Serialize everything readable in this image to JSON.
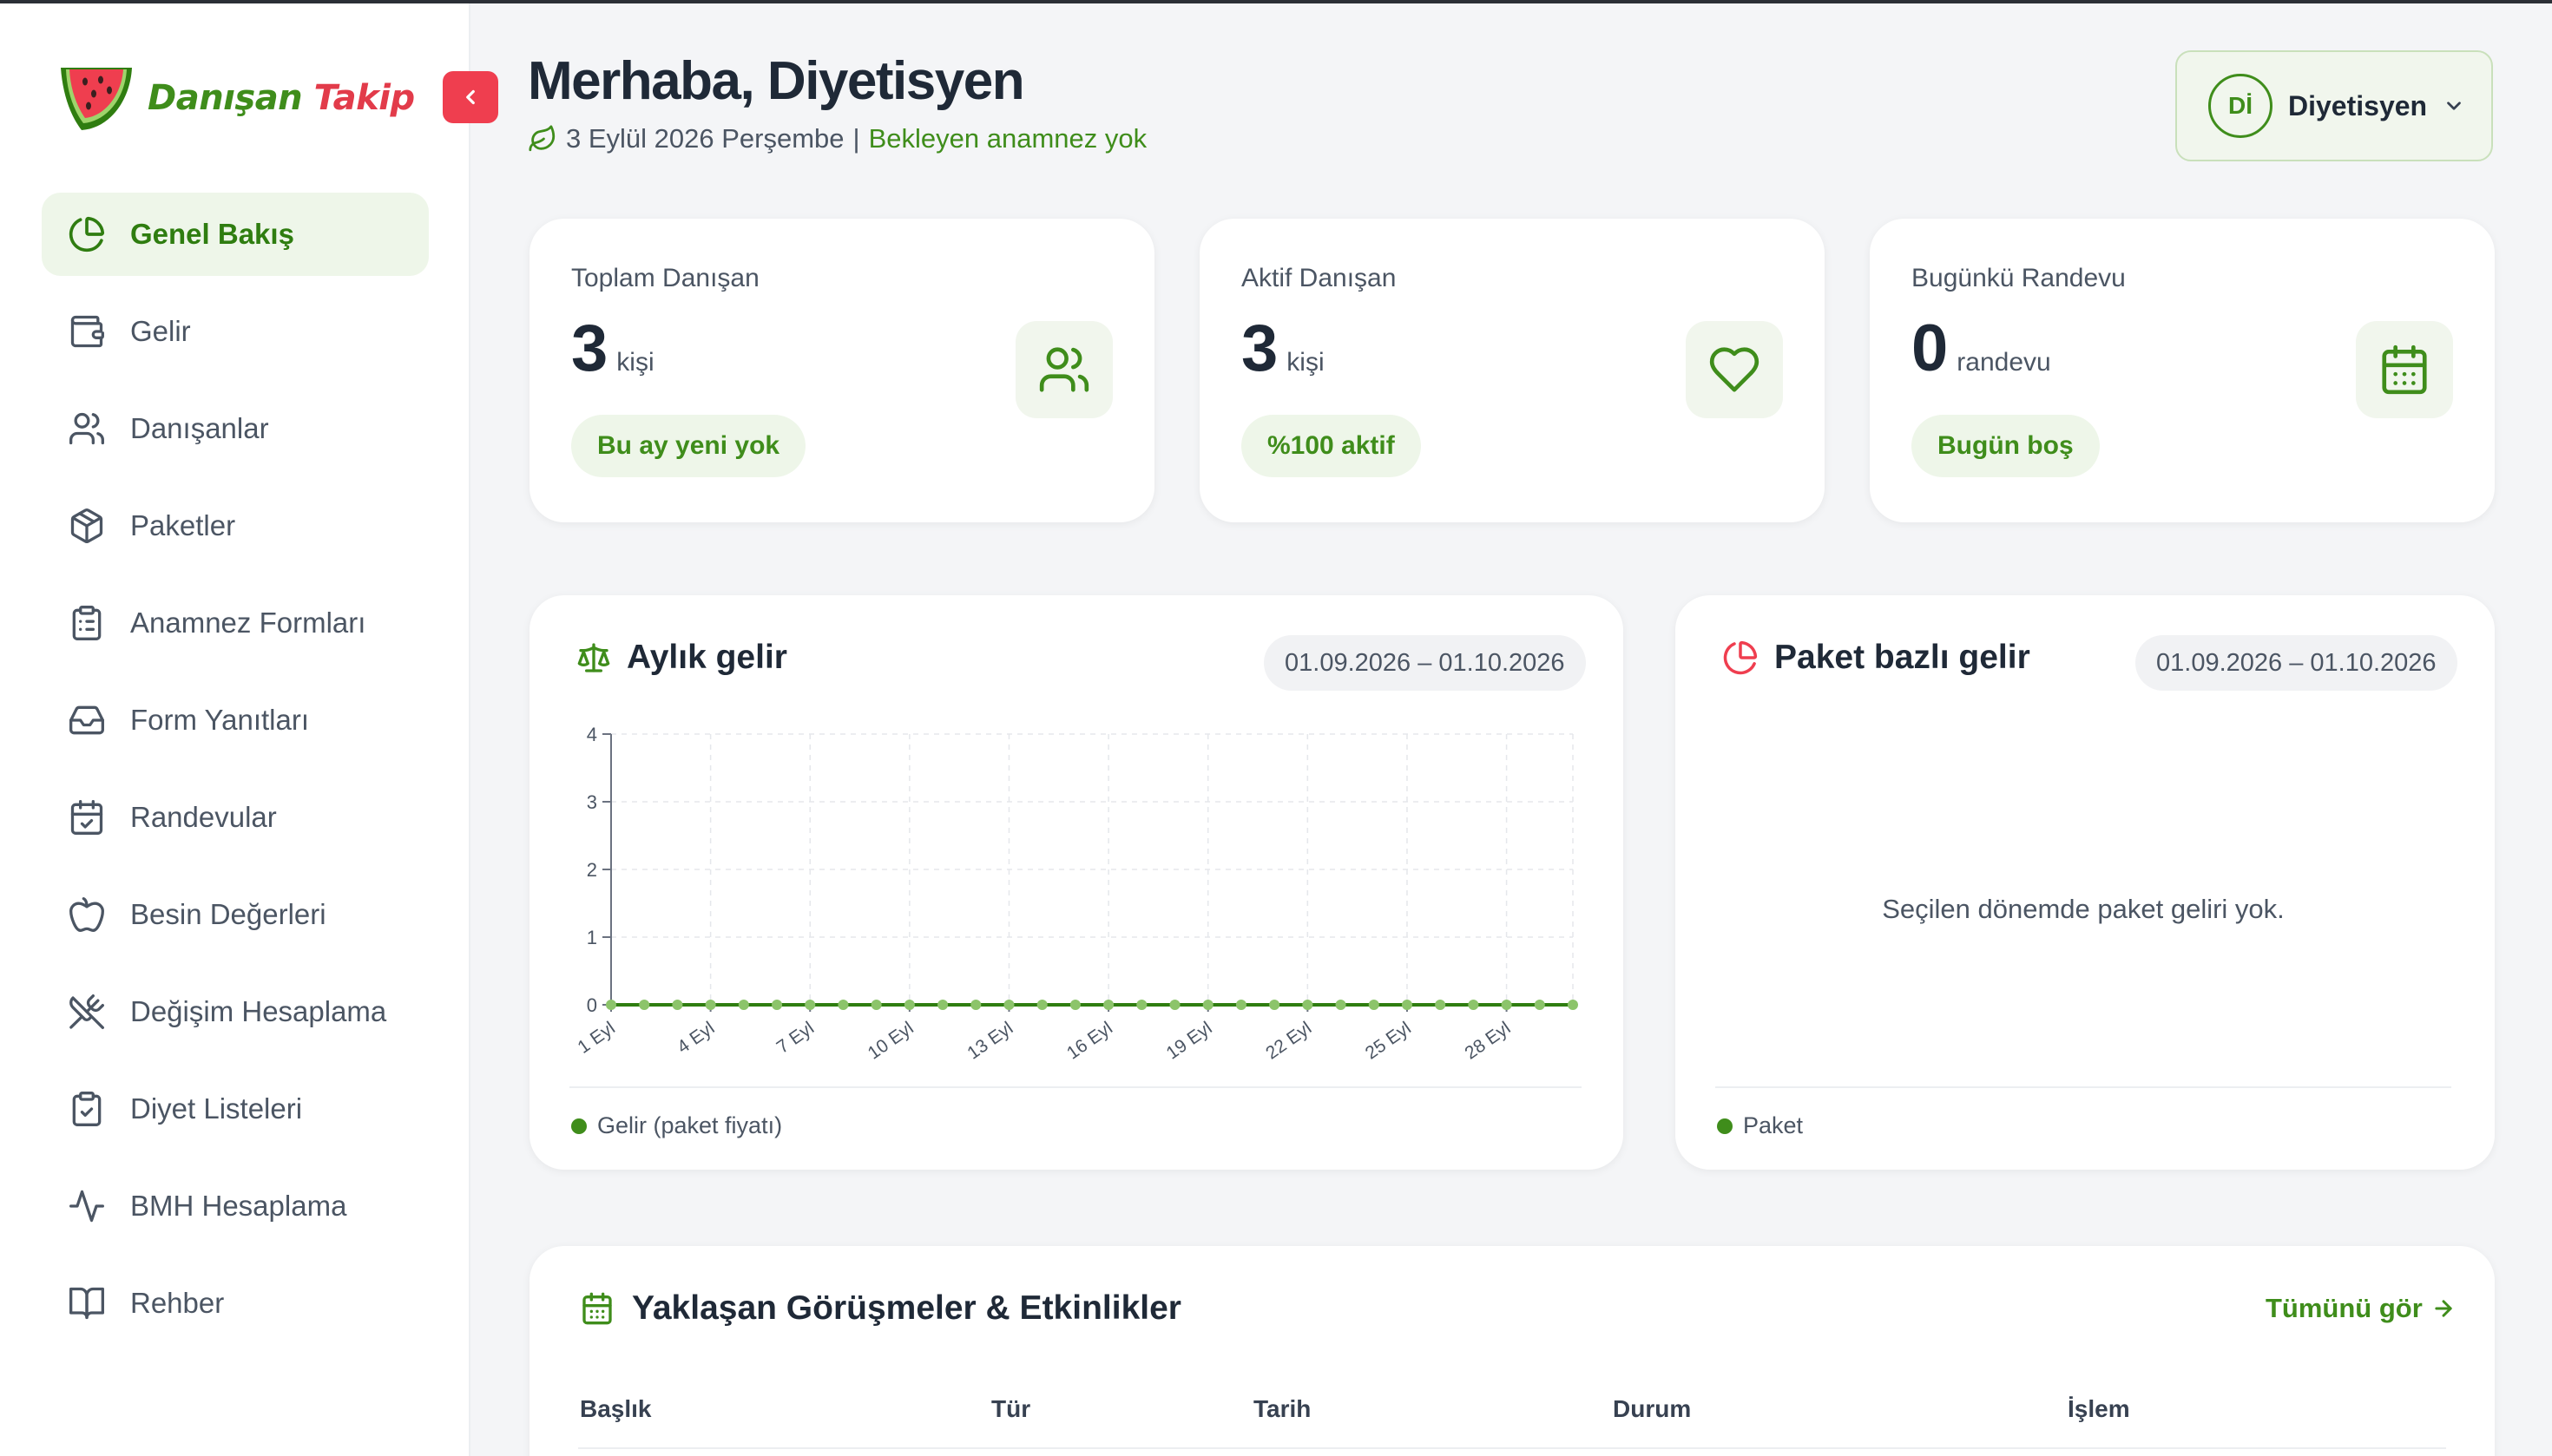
{
  "brand": {
    "name_part1": "Danışan",
    "name_part2": "Takip"
  },
  "nav": {
    "items": [
      {
        "label": "Genel Bakış",
        "icon": "pie-chart-icon",
        "active": true
      },
      {
        "label": "Gelir",
        "icon": "wallet-icon"
      },
      {
        "label": "Danışanlar",
        "icon": "users-icon"
      },
      {
        "label": "Paketler",
        "icon": "package-icon"
      },
      {
        "label": "Anamnez Formları",
        "icon": "clipboard-list-icon"
      },
      {
        "label": "Form Yanıtları",
        "icon": "inbox-icon"
      },
      {
        "label": "Randevular",
        "icon": "calendar-check-icon"
      },
      {
        "label": "Besin Değerleri",
        "icon": "apple-icon"
      },
      {
        "label": "Değişim Hesaplama",
        "icon": "utensils-off-icon"
      },
      {
        "label": "Diyet Listeleri",
        "icon": "clipboard-check-icon"
      },
      {
        "label": "BMH Hesaplama",
        "icon": "activity-icon"
      },
      {
        "label": "Rehber",
        "icon": "book-open-icon"
      }
    ]
  },
  "header": {
    "greeting": "Merhaba, Diyetisyen",
    "date": "3 Eylül 2026 Perşembe",
    "separator": "|",
    "pending": "Bekleyen anamnez yok",
    "user": {
      "initials": "Dİ",
      "name": "Diyetisyen"
    }
  },
  "stats": [
    {
      "label": "Toplam Danışan",
      "value": "3",
      "unit": "kişi",
      "badge": "Bu ay yeni yok",
      "icon": "users-icon"
    },
    {
      "label": "Aktif Danışan",
      "value": "3",
      "unit": "kişi",
      "badge": "%100 aktif",
      "icon": "heart-icon"
    },
    {
      "label": "Bugünkü Randevu",
      "value": "0",
      "unit": "randevu",
      "badge": "Bugün boş",
      "icon": "calendar-icon"
    }
  ],
  "monthly_income": {
    "title": "Aylık gelir",
    "date_range": "01.09.2026 – 01.10.2026",
    "legend": "Gelir (paket fiyatı)"
  },
  "package_income": {
    "title": "Paket bazlı gelir",
    "date_range": "01.09.2026 – 01.10.2026",
    "empty": "Seçilen dönemde paket geliri yok.",
    "legend": "Paket"
  },
  "upcoming": {
    "title": "Yaklaşan Görüşmeler & Etkinlikler",
    "see_all": "Tümünü gör",
    "columns": [
      "Başlık",
      "Tür",
      "Tarih",
      "Durum",
      "İşlem"
    ]
  },
  "colors": {
    "accent": "#3f8d1b",
    "danger": "#ef3e4f",
    "line": "#2f7d10",
    "point": "#8cc46a"
  },
  "chart_data": {
    "type": "line",
    "x": [
      "1 Eyl",
      "2 Eyl",
      "3 Eyl",
      "4 Eyl",
      "5 Eyl",
      "6 Eyl",
      "7 Eyl",
      "8 Eyl",
      "9 Eyl",
      "10 Eyl",
      "11 Eyl",
      "12 Eyl",
      "13 Eyl",
      "14 Eyl",
      "15 Eyl",
      "16 Eyl",
      "17 Eyl",
      "18 Eyl",
      "19 Eyl",
      "20 Eyl",
      "21 Eyl",
      "22 Eyl",
      "23 Eyl",
      "24 Eyl",
      "25 Eyl",
      "26 Eyl",
      "27 Eyl",
      "28 Eyl",
      "29 Eyl",
      "30 Eyl"
    ],
    "xtick_labels": [
      "1 Eyl",
      "4 Eyl",
      "7 Eyl",
      "10 Eyl",
      "13 Eyl",
      "16 Eyl",
      "19 Eyl",
      "22 Eyl",
      "25 Eyl",
      "28 Eyl"
    ],
    "series": [
      {
        "name": "Gelir (paket fiyatı)",
        "values": [
          0,
          0,
          0,
          0,
          0,
          0,
          0,
          0,
          0,
          0,
          0,
          0,
          0,
          0,
          0,
          0,
          0,
          0,
          0,
          0,
          0,
          0,
          0,
          0,
          0,
          0,
          0,
          0,
          0,
          0
        ]
      }
    ],
    "ylim": [
      0,
      4
    ],
    "yticks": [
      0,
      1,
      2,
      3,
      4
    ],
    "grid": true
  }
}
